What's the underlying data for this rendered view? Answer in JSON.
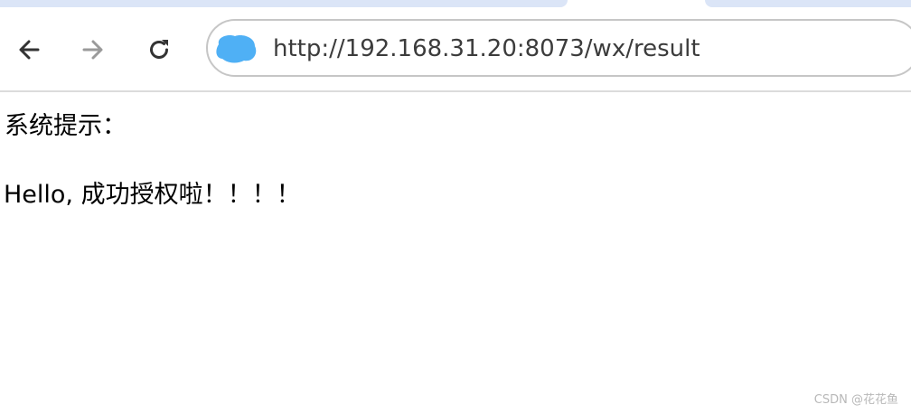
{
  "browser": {
    "nav": {
      "back_icon": "arrow-left-icon",
      "forward_icon": "arrow-right-icon",
      "reload_icon": "reload-icon"
    },
    "address_bar": {
      "url": "http://192.168.31.20:8073/wx/result",
      "site_icon": "site-info-icon"
    },
    "colors": {
      "tab_background": "#dbe5f7",
      "site_icon": "#4fb0f5",
      "icon_dark": "#333333",
      "icon_disabled": "#9a9a9a"
    }
  },
  "page": {
    "heading": "系统提示：",
    "message": "Hello, 成功授权啦！！！！"
  },
  "watermark": "CSDN @花花鱼"
}
